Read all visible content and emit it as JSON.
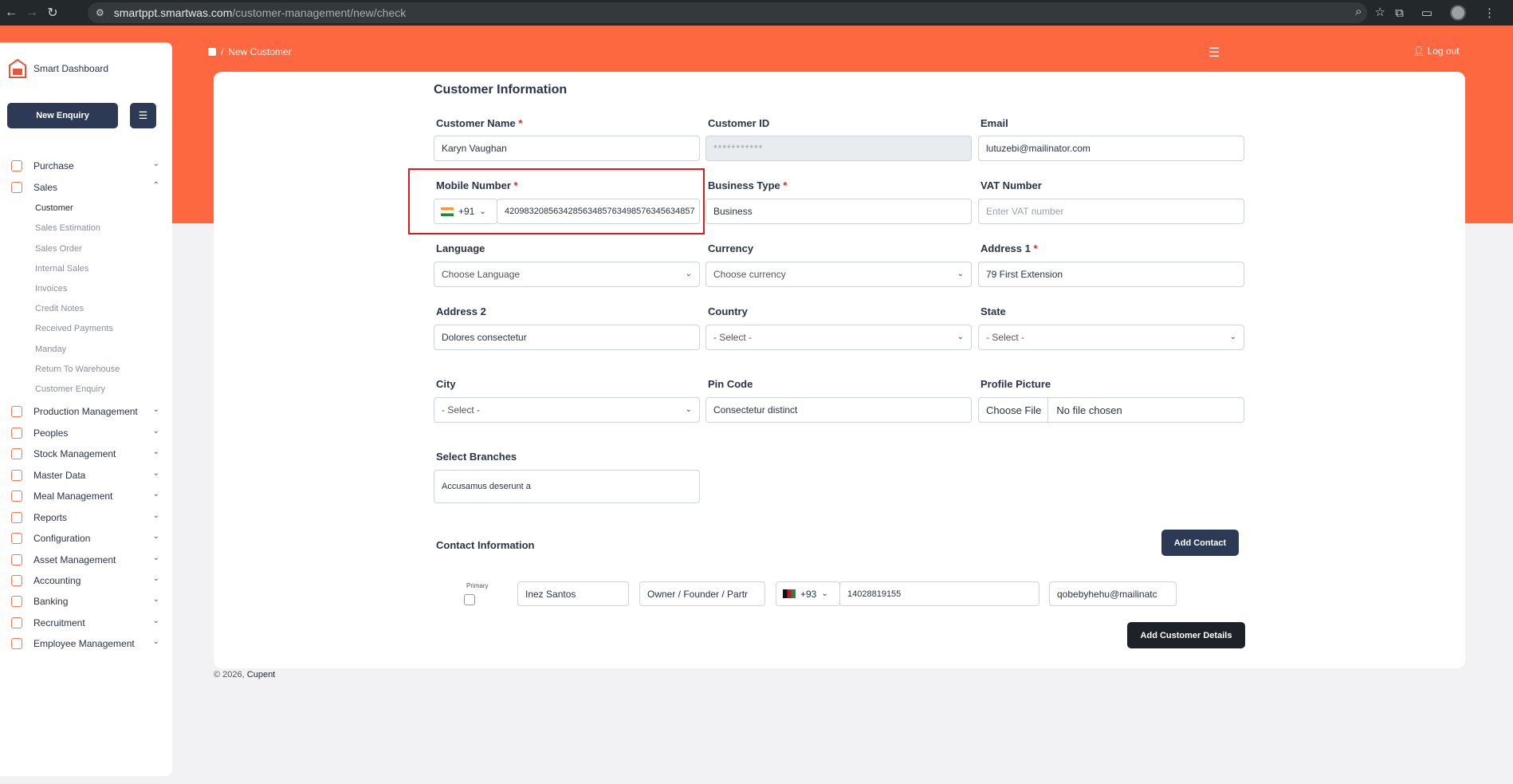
{
  "browser": {
    "url_host": "smartppt.smartwas.com",
    "url_path": "/customer-management/new/check"
  },
  "app": {
    "brand": "Smart Dashboard"
  },
  "sidebar": {
    "new_enquiry": "New Enquiry",
    "items": [
      {
        "label": "Purchase"
      },
      {
        "label": "Sales"
      },
      {
        "label": "Production Management"
      },
      {
        "label": "Peoples"
      },
      {
        "label": "Stock Management"
      },
      {
        "label": "Master Data"
      },
      {
        "label": "Meal Management"
      },
      {
        "label": "Reports"
      },
      {
        "label": "Configuration"
      },
      {
        "label": "Asset Management"
      },
      {
        "label": "Accounting"
      },
      {
        "label": "Banking"
      },
      {
        "label": "Recruitment"
      },
      {
        "label": "Employee Management"
      }
    ],
    "sales_sub": [
      {
        "label": "Customer"
      },
      {
        "label": "Sales Estimation"
      },
      {
        "label": "Sales Order"
      },
      {
        "label": "Internal Sales"
      },
      {
        "label": "Invoices"
      },
      {
        "label": "Credit Notes"
      },
      {
        "label": "Received Payments"
      },
      {
        "label": "Manday"
      },
      {
        "label": "Return To Warehouse"
      },
      {
        "label": "Customer Enquiry"
      }
    ]
  },
  "header": {
    "breadcrumb_sep": "/",
    "breadcrumb": "New Customer",
    "logout": "Log out"
  },
  "form": {
    "title": "Customer Information",
    "customer_name": {
      "label": "Customer Name",
      "value": "Karyn Vaughan"
    },
    "customer_id": {
      "label": "Customer ID",
      "value": "***********"
    },
    "email": {
      "label": "Email",
      "value": "lutuzebi@mailinator.com"
    },
    "mobile": {
      "label": "Mobile Number",
      "code": "+91",
      "value": "420983208563428563485763498576345634857"
    },
    "business_type": {
      "label": "Business Type",
      "value": "Business"
    },
    "vat": {
      "label": "VAT Number",
      "placeholder": "Enter VAT number"
    },
    "language": {
      "label": "Language",
      "value": "Choose Language"
    },
    "currency": {
      "label": "Currency",
      "value": "Choose currency"
    },
    "address1": {
      "label": "Address 1",
      "value": "79 First Extension"
    },
    "address2": {
      "label": "Address 2",
      "value": "Dolores consectetur"
    },
    "country": {
      "label": "Country",
      "value": "- Select -"
    },
    "state": {
      "label": "State",
      "value": "- Select -"
    },
    "city": {
      "label": "City",
      "value": "- Select -"
    },
    "pincode": {
      "label": "Pin Code",
      "value": "Consectetur distinct"
    },
    "profile": {
      "label": "Profile Picture",
      "button": "Choose File",
      "status": "No file chosen"
    },
    "branches": {
      "label": "Select Branches",
      "value": "Accusamus deserunt a"
    },
    "required_mark": "*"
  },
  "contact": {
    "title": "Contact Information",
    "add_button": "Add Contact",
    "primary_label": "Primary",
    "name": "Inez Santos",
    "role": "Owner / Founder / Partr",
    "code": "+93",
    "phone": "14028819155",
    "email": "qobebyhehu@mailinatc"
  },
  "submit": "Add Customer Details",
  "footer": {
    "text": "© 2026,",
    "link": "Cupent"
  }
}
